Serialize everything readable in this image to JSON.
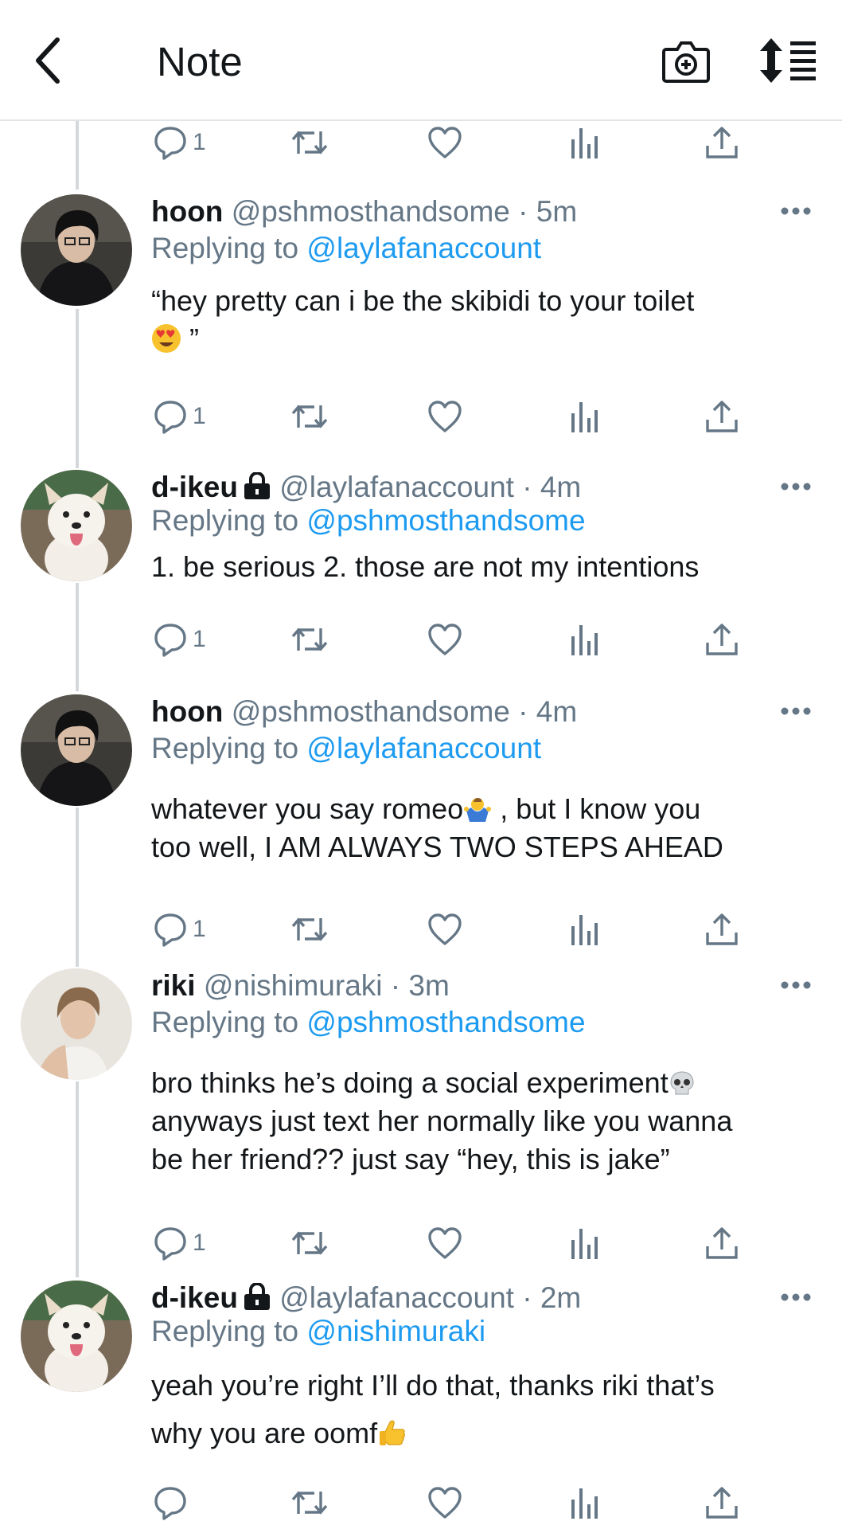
{
  "header": {
    "title": "Note"
  },
  "icons": {
    "back": "chevron-left-icon",
    "camera": "camera-add-icon",
    "sort": "sort-icon",
    "reply": "reply-icon",
    "retweet": "retweet-icon",
    "like": "heart-icon",
    "views": "views-icon",
    "share": "share-icon",
    "more": "more-icon",
    "lock": "lock-icon"
  },
  "colors": {
    "accent": "#1d9bf0",
    "muted": "#657786",
    "text": "#14171a"
  },
  "top_actions": {
    "reply_count": "1"
  },
  "tweets": [
    {
      "name": "hoon",
      "handle": "@pshmosthandsome",
      "time": "5m",
      "replying_prefix": "Replying to",
      "replying_to": "@laylafanaccount",
      "text_lines": [
        "“hey pretty can i be the skibidi to your toilet",
        "”"
      ],
      "emoji": "heart-eyes-emoji",
      "reply_count": "1"
    },
    {
      "name": "d-ikeu",
      "handle": "@laylafanaccount",
      "time": "4m",
      "replying_prefix": "Replying to",
      "replying_to": "@pshmosthandsome",
      "text_lines": [
        "1. be serious 2. those are not my intentions"
      ],
      "reply_count": "1"
    },
    {
      "name": "hoon",
      "handle": "@pshmosthandsome",
      "time": "4m",
      "replying_prefix": "Replying to",
      "replying_to": "@laylafanaccount",
      "text_lines": [
        "whatever you say romeo",
        " , but I know you",
        "too well, I AM ALWAYS TWO STEPS AHEAD"
      ],
      "emoji": "man-shrugging-emoji",
      "reply_count": "1"
    },
    {
      "name": "riki",
      "handle": "@nishimuraki",
      "time": "3m",
      "replying_prefix": "Replying to",
      "replying_to": "@pshmosthandsome",
      "text_lines": [
        "bro thinks he’s doing a social experiment",
        "anyways just text her normally like you wanna",
        "be her friend?? just say “hey, this is jake”"
      ],
      "emoji": "skull-emoji",
      "reply_count": "1"
    },
    {
      "name": "d-ikeu",
      "handle": "@laylafanaccount",
      "time": "2m",
      "replying_prefix": "Replying to",
      "replying_to": "@nishimuraki",
      "text_lines": [
        "yeah you’re right I’ll do that, thanks riki that’s",
        "why you are oomf"
      ],
      "emoji": "thumbs-up-emoji"
    }
  ]
}
